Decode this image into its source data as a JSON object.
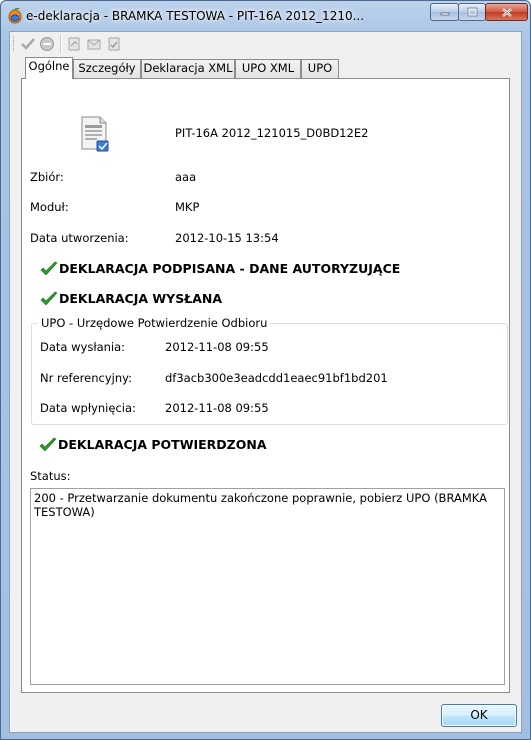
{
  "window": {
    "title": "e-deklaracja - BRAMKA TESTOWA - PIT-16A 2012_1210...",
    "accent": "#a9c4e5"
  },
  "tabs": [
    {
      "label": "Ogólne",
      "active": true
    },
    {
      "label": "Szczegóły",
      "active": false
    },
    {
      "label": "Deklaracja XML",
      "active": false
    },
    {
      "label": "UPO XML",
      "active": false
    },
    {
      "label": "UPO",
      "active": false
    }
  ],
  "general": {
    "doc_name": "PIT-16A 2012_121015_D0BD12E2",
    "zbior_label": "Zbiór:",
    "zbior_value": "aaa",
    "modul_label": "Moduł:",
    "modul_value": "MKP",
    "created_label": "Data utworzenia:",
    "created_value": "2012-10-15 13:54"
  },
  "statuses": {
    "signed": "DEKLARACJA PODPISANA - DANE AUTORYZUJĄCE",
    "sent": "DEKLARACJA WYSŁANA",
    "confirmed": "DEKLARACJA POTWIERDZONA",
    "check_color": "#2e9a2a"
  },
  "upo": {
    "group_title": "UPO - Urzędowe Potwierdzenie Odbioru",
    "sent_label": "Data wysłania:",
    "sent_value": "2012-11-08 09:55",
    "ref_label": "Nr referencyjny:",
    "ref_value": "df3acb300e3eadcdd1eaec91bf1bd201",
    "received_label": "Data wpłynięcia:",
    "received_value": "2012-11-08 09:55"
  },
  "status": {
    "label": "Status:",
    "text": "200 - Przetwarzanie dokumentu zakończone poprawnie, pobierz UPO (BRAMKA TESTOWA)"
  },
  "buttons": {
    "ok": "OK"
  },
  "toolbar": {
    "icons": [
      "check-icon",
      "block-icon",
      "sign-icon",
      "send-icon",
      "receive-icon"
    ]
  }
}
